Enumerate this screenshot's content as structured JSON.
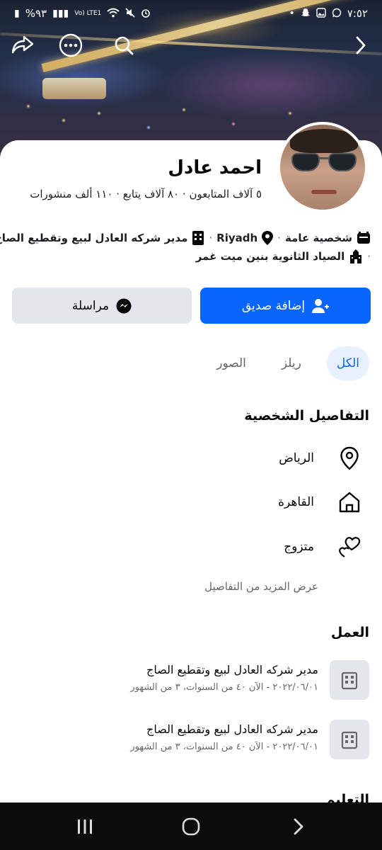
{
  "status_bar": {
    "time": "٧:٥٢",
    "battery": "%٩٣",
    "network": "Vo) LTE1"
  },
  "profile": {
    "name": "احمد عادل",
    "stats": "٥ آلاف المتابعون · ٨٠ آلاف يتابع · ١١٠ ألف منشورات",
    "category": "شخصية عامة",
    "city": "Riyadh",
    "job": "مدير شركه العادل لبيع وتقطيع الصاج",
    "school": "الصياد الثانوية بنين ميت غمر"
  },
  "actions": {
    "add_friend": "إضافة صديق",
    "message": "مراسلة"
  },
  "tabs": [
    {
      "label": "الكل",
      "active": true
    },
    {
      "label": "ريلز",
      "active": false
    },
    {
      "label": "الصور",
      "active": false
    }
  ],
  "details": {
    "title": "التفاصيل الشخصية",
    "items": [
      {
        "icon": "location-pin-icon",
        "text": "الرياض"
      },
      {
        "icon": "home-icon",
        "text": "القاهرة"
      },
      {
        "icon": "hearts-icon",
        "text": "متزوج"
      }
    ],
    "more": "عرض المزيد من التفاصيل"
  },
  "work": {
    "title": "العمل",
    "items": [
      {
        "title": "مدير شركه العادل لبيع وتقطيع الصاج",
        "sub": "٢٠٢٢/٠٦/٠١ - الآن ٤٠ من السنوات، ٣ من الشهور"
      },
      {
        "title": "مدير شركه العادل لبيع وتقطيع الصاج",
        "sub": "٢٠٢٢/٠٦/٠١ - الآن ٤٠ من السنوات، ٣ من الشهور"
      }
    ]
  },
  "education": {
    "title": "التعليم"
  },
  "colors": {
    "primary": "#0866ff",
    "secondary_bg": "#e4e6eb",
    "muted_text": "#65676b"
  }
}
